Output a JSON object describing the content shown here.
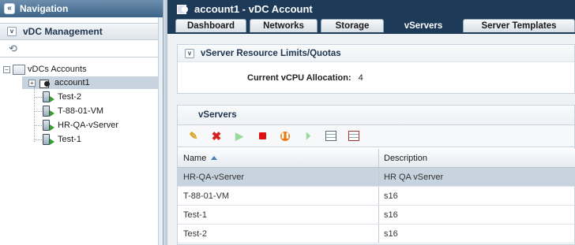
{
  "navigation": {
    "title": "Navigation",
    "collapse_label": "«"
  },
  "vdc_management": {
    "title": "vDC Management",
    "toggle": "v"
  },
  "tree": {
    "root_label": "vDCs Accounts",
    "account_label": "account1",
    "vservers": [
      {
        "label": "Test-2"
      },
      {
        "label": "T-88-01-VM"
      },
      {
        "label": "HR-QA-vServer"
      },
      {
        "label": "Test-1"
      }
    ]
  },
  "window": {
    "title": "account1 - vDC Account"
  },
  "tabs": [
    {
      "label": "Dashboard",
      "active": false
    },
    {
      "label": "Networks",
      "active": false
    },
    {
      "label": "Storage",
      "active": false
    },
    {
      "label": "vServers",
      "active": true
    },
    {
      "label": "Server Templates",
      "active": false
    }
  ],
  "quota_panel": {
    "title": "vServer Resource Limits/Quotas",
    "vcpu_label": "Current vCPU Allocation:",
    "vcpu_value": "4"
  },
  "vservers_panel": {
    "title": "vServers",
    "toolbar": [
      "edit-icon",
      "delete-icon",
      "start-icon",
      "stop-icon",
      "pause-icon",
      "resume-icon",
      "template-icon",
      "export-icon"
    ],
    "columns": {
      "name": "Name",
      "description": "Description"
    },
    "rows": [
      {
        "name": "HR-QA-vServer",
        "description": "HR QA vServer",
        "selected": true
      },
      {
        "name": "T-88-01-VM",
        "description": "s16",
        "selected": false
      },
      {
        "name": "Test-1",
        "description": "s16",
        "selected": false
      },
      {
        "name": "Test-2",
        "description": "s16",
        "selected": false
      }
    ]
  },
  "colors": {
    "header_dark": "#1d3a58",
    "selection": "#c7d3df",
    "accent": "#4c7bb4"
  }
}
